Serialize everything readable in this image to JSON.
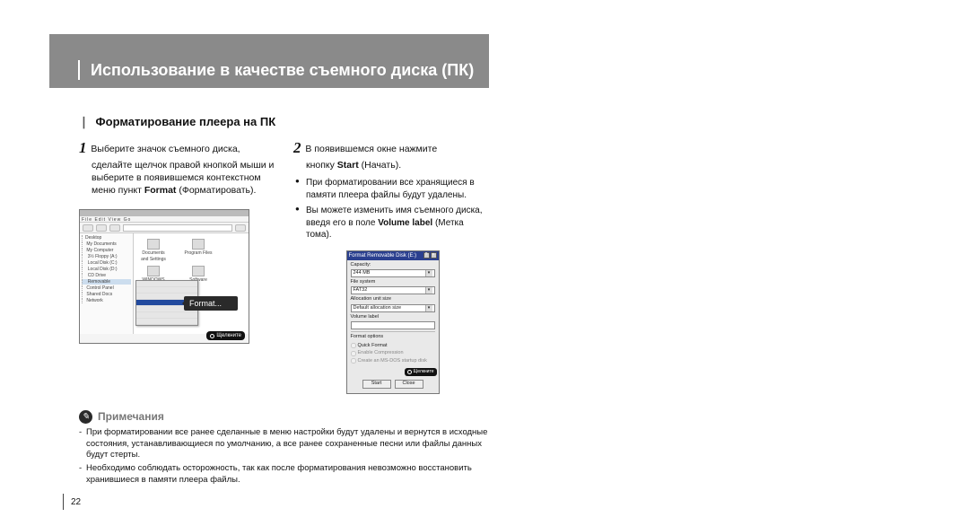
{
  "header": {
    "title": "Использование в качестве съемного диска (ПК)"
  },
  "section": {
    "heading": "Форматирование плеера на ПК"
  },
  "step1": {
    "text_line1": "Выберите значок съемного диска,",
    "text_rest": "сделайте щелчок правой кнопкой мыши и выберите в появившемся контекстном меню пункт ",
    "bold": "Format",
    "tail": " (Форматировать)."
  },
  "step2": {
    "text_line1": "В появившемся окне нажмите",
    "text_line2a": "кнопку ",
    "bold": "Start",
    "text_line2b": " (Начать).",
    "bullets": [
      "При форматировании все хранящиеся в памяти плеера файлы будут удалены.",
      "Вы можете изменить имя съемного диска, введя его в поле Volume label (Метка тома)."
    ],
    "b2_pre": "Вы можете изменить имя съемного диска, введя его в поле ",
    "b2_bold": "Volume label",
    "b2_post": " (Метка тома)."
  },
  "explorer": {
    "context_bubble": "Format...",
    "status": "Щелкните"
  },
  "format_dialog": {
    "caption": "Format Removable Disk (E:)",
    "labels": {
      "capacity": "Capacity:",
      "capacity_val": "244 MB",
      "filesystem": "File system",
      "filesystem_val": "FAT32",
      "alloc": "Allocation unit size",
      "alloc_val": "Default allocation size",
      "volume": "Volume label",
      "options": "Format options",
      "quick": "Quick Format",
      "compress": "Enable Compression",
      "msdos": "Create an MS-DOS startup disk"
    },
    "buttons": {
      "start": "Start",
      "close": "Close"
    },
    "status": "Щелкните"
  },
  "notes": {
    "title": "Примечания",
    "items": [
      "При форматировании все ранее сделанные в меню настройки будут удалены и вернутся в исходные состояния, устанавливающиеся по умолчанию, а все ранее сохраненные песни или файлы данных будут стерты.",
      "Необходимо соблюдать осторожность, так как после форматирования невозможно восстановить хранившиеся в памяти плеера файлы."
    ]
  },
  "page_number": "22"
}
